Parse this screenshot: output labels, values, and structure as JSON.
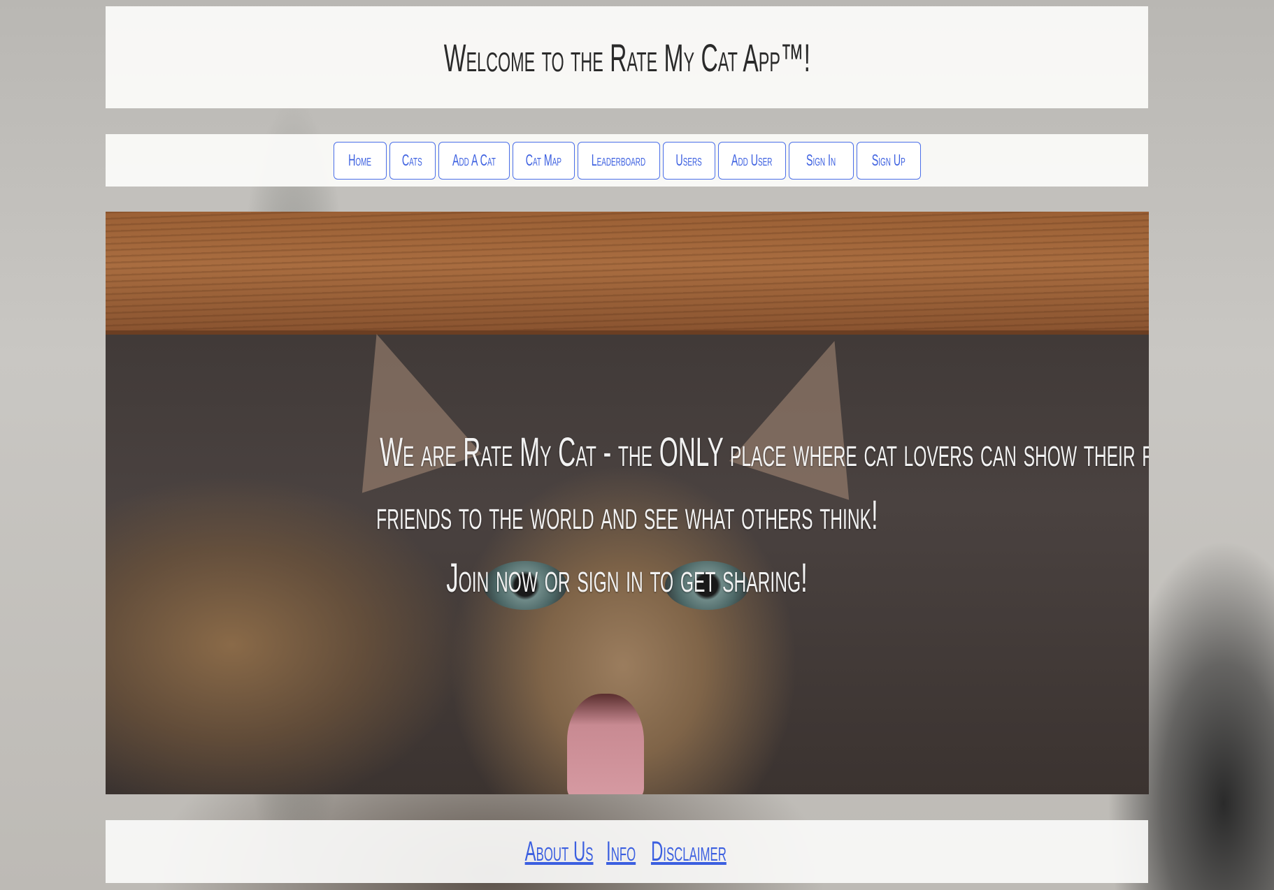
{
  "header": {
    "title": "Welcome to the Rate My Cat App™!"
  },
  "nav": {
    "items": [
      {
        "label": "Home"
      },
      {
        "label": "Cats"
      },
      {
        "label": "Add A Cat"
      },
      {
        "label": "Cat Map"
      },
      {
        "label": "Leaderboard"
      },
      {
        "label": "Users"
      },
      {
        "label": "Add User"
      },
      {
        "label": "Sign In"
      },
      {
        "label": "Sign Up"
      }
    ]
  },
  "hero": {
    "line1": "We are Rate My Cat - the ONLY place where cat lovers can show their feline",
    "line2": "friends to the world and see what others think!",
    "line3": "Join now or sign in to get sharing!"
  },
  "footer": {
    "links": [
      {
        "label": "About Us"
      },
      {
        "label": "Info"
      },
      {
        "label": "Disclaimer"
      }
    ]
  },
  "colors": {
    "link": "#3b5fe0",
    "panel": "#fafaf8",
    "title_text": "#2a2a2a"
  }
}
